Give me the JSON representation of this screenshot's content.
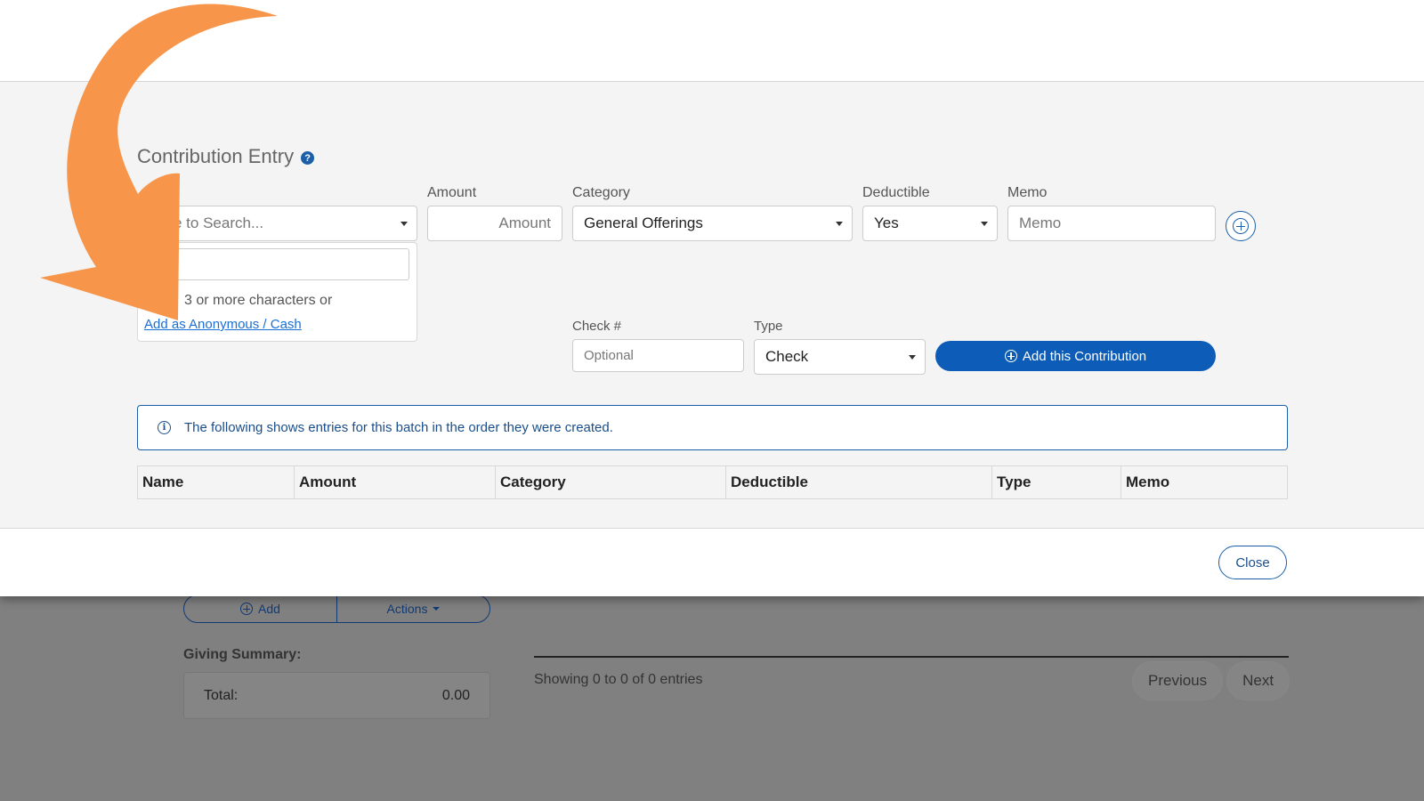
{
  "background": {
    "add_label": "Add",
    "actions_label": "Actions",
    "giving_summary_label": "Giving Summary:",
    "total_label": "Total:",
    "total_value": "0.00",
    "showing_text": "Showing 0 to 0 of 0 entries",
    "previous_label": "Previous",
    "next_label": "Next"
  },
  "modal": {
    "title": "Contribution Entry",
    "help_icon": "?",
    "name_label_fragment": "e",
    "name_placeholder_fragment": "e to Search...",
    "amount_label": "Amount",
    "amount_placeholder": "Amount",
    "category_label": "Category",
    "category_value": "General Offerings",
    "deductible_label": "Deductible",
    "deductible_value": "Yes",
    "memo_label": "Memo",
    "memo_placeholder": "Memo",
    "dropdown": {
      "hint_fragment": "3 or more characters or",
      "anonymous_link": "Add as Anonymous / Cash"
    },
    "check_label": "Check #",
    "check_placeholder": "Optional",
    "type_label": "Type",
    "type_value": "Check",
    "add_contribution_label": "Add this Contribution",
    "info_icon": "i",
    "info_text": "The following shows entries for this batch in the order they were created.",
    "table_headers": [
      "Name",
      "Amount",
      "Category",
      "Deductible",
      "Type",
      "Memo"
    ],
    "close_label": "Close"
  },
  "colors": {
    "accent": "#0c5cb8",
    "annotation_arrow": "#f7964a"
  }
}
